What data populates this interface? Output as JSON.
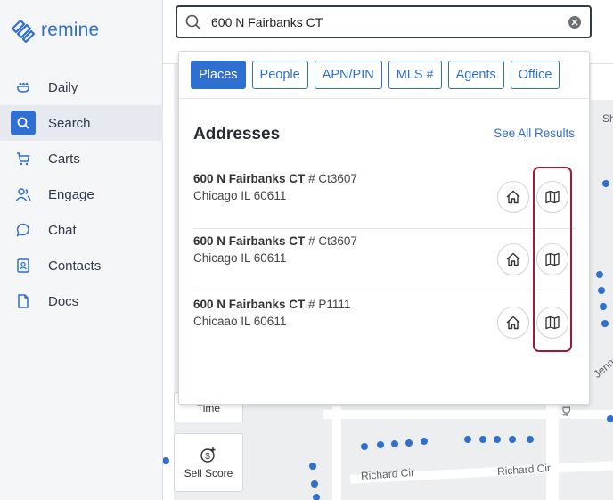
{
  "app": {
    "brand": "remine"
  },
  "sidebar": {
    "items": [
      {
        "label": "Daily",
        "icon": "daily-icon"
      },
      {
        "label": "Search",
        "icon": "search-icon",
        "active": true
      },
      {
        "label": "Carts",
        "icon": "cart-icon"
      },
      {
        "label": "Engage",
        "icon": "users-icon"
      },
      {
        "label": "Chat",
        "icon": "chat-icon"
      },
      {
        "label": "Contacts",
        "icon": "contacts-icon"
      },
      {
        "label": "Docs",
        "icon": "document-icon"
      }
    ]
  },
  "search": {
    "value": "600 N Fairbanks CT",
    "placeholder": ""
  },
  "filters": [
    "Places",
    "People",
    "APN/PIN",
    "MLS #",
    "Agents",
    "Office"
  ],
  "results": {
    "title": "Addresses",
    "see_all": "See All Results",
    "items": [
      {
        "street": "600 N Fairbanks CT",
        "unit": "# Ct3607",
        "city": "Chicago IL 60611"
      },
      {
        "street": "600 N Fairbanks CT",
        "unit": "# Ct3607",
        "city": "Chicago IL 60611"
      },
      {
        "street": "600 N Fairbanks CT",
        "unit": "# P1111",
        "city": "Chicaao IL 60611"
      }
    ]
  },
  "map": {
    "tools": {
      "time_label": "Time",
      "sell_score_label": "Sell Score"
    },
    "streets": {
      "richard_cir_1": "Richard Cir",
      "richard_cir_2": "Richard Cir",
      "edge_dr": "Dr",
      "edge_sh": "Sh",
      "edge_jenne": "Jenne"
    }
  },
  "colors": {
    "accent": "#2f6fcf",
    "highlight": "#9b1c3a",
    "dots": "#2f6fcf"
  }
}
